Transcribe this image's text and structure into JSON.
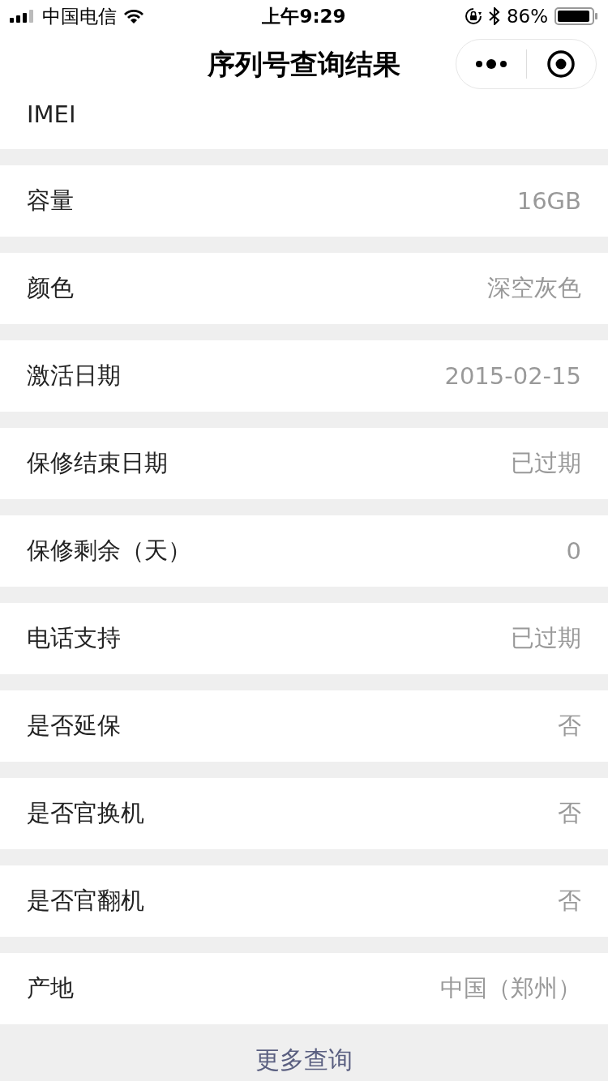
{
  "status_bar": {
    "carrier": "中国电信",
    "time": "上午9:29",
    "battery": "86%"
  },
  "nav_bar": {
    "title": "序列号查询结果"
  },
  "partial_row": {
    "label": "IMEI"
  },
  "rows": [
    {
      "label": "容量",
      "value": "16GB"
    },
    {
      "label": "颜色",
      "value": "深空灰色"
    },
    {
      "label": "激活日期",
      "value": "2015-02-15"
    },
    {
      "label": "保修结束日期",
      "value": "已过期"
    },
    {
      "label": "保修剩余（天）",
      "value": "0"
    },
    {
      "label": "电话支持",
      "value": "已过期"
    },
    {
      "label": "是否延保",
      "value": "否"
    },
    {
      "label": "是否官换机",
      "value": "否"
    },
    {
      "label": "是否官翻机",
      "value": "否"
    },
    {
      "label": "产地",
      "value": "中国（郑州）"
    }
  ],
  "footer": {
    "link": "更多查询"
  }
}
